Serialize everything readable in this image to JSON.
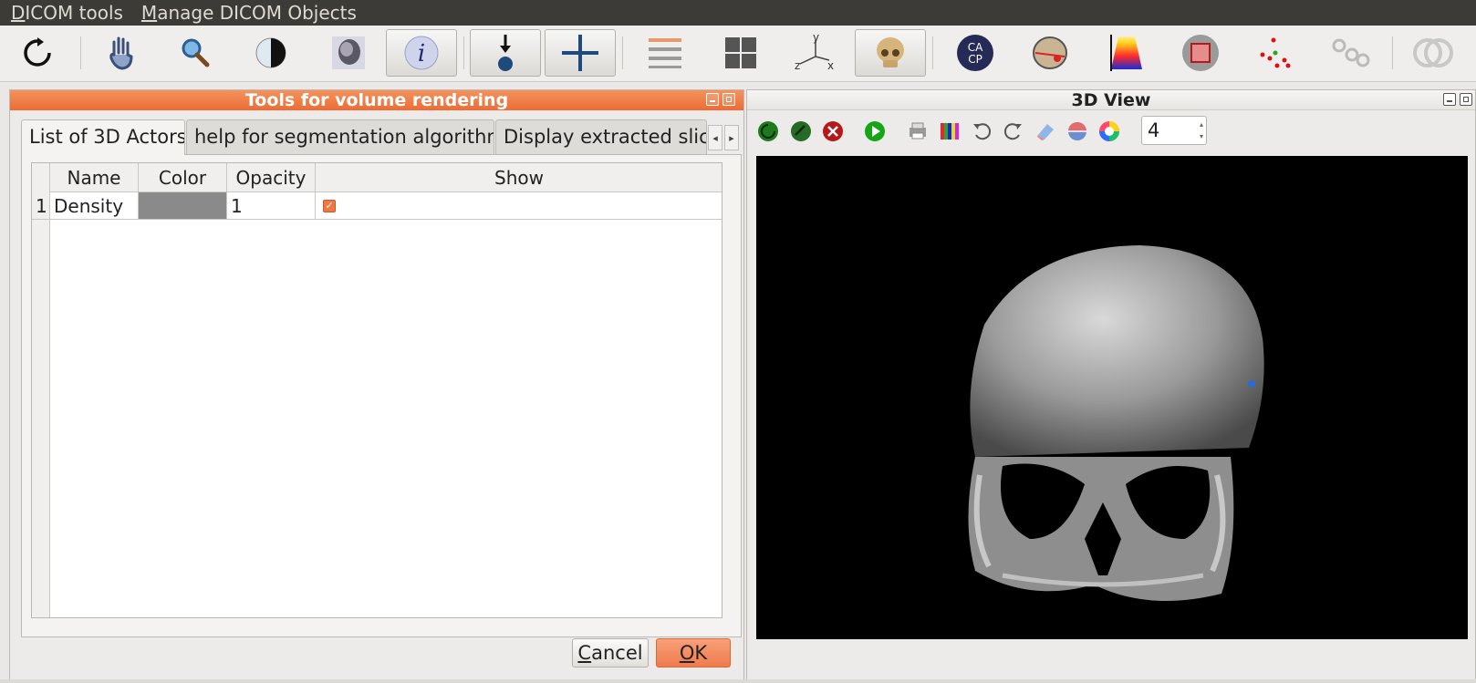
{
  "menubar": {
    "items": [
      {
        "accel": "D",
        "rest": "ICOM tools"
      },
      {
        "accel": "M",
        "rest": "anage DICOM Objects"
      }
    ]
  },
  "toolbar": {
    "buttons": [
      "reset-icon",
      "hand-pan-icon",
      "zoom-magnifier-icon",
      "contrast-icon",
      "head-scan-icon",
      "info-icon",
      "point-marker-icon",
      "crosshair-plus-icon",
      "horizontal-lines-icon",
      "grid-layout-icon",
      "axes-xyz-icon",
      "skull-3d-icon",
      "cacp-icon",
      "skull-measure-icon",
      "color-ramp-icon",
      "cube-icon",
      "point-cloud-icon",
      "path-icon",
      "rings-icon"
    ],
    "axes_labels": {
      "y": "y",
      "z": "z",
      "x": "x"
    },
    "cacp_text": {
      "line1": "CA",
      "line2": "CP"
    }
  },
  "left_panel": {
    "title": "Tools for volume rendering",
    "tabs": [
      {
        "label": "List of 3D Actors",
        "active": true
      },
      {
        "label": "help for segmentation algorithm",
        "active": false
      },
      {
        "label": "Display extracted slice",
        "active": false
      }
    ],
    "table": {
      "columns": [
        "Name",
        "Color",
        "Opacity",
        "Show"
      ],
      "rows": [
        {
          "index": "1",
          "name": "Density",
          "color": "#8a8a8a",
          "opacity": "1",
          "show": true
        }
      ]
    },
    "buttons": {
      "cancel": {
        "accel": "C",
        "rest": "ancel"
      },
      "ok": {
        "accel": "O",
        "rest": "K"
      }
    }
  },
  "right_panel": {
    "title": "3D View",
    "tools": [
      "refresh-green-icon",
      "rotate-green-icon",
      "close-red-icon",
      "play-icon",
      "printer-icon",
      "color-bars-icon",
      "undo-icon",
      "redo-icon",
      "eraser-icon",
      "sphere-cut-icon",
      "color-wheel-icon"
    ],
    "spin_value": "4"
  },
  "colors": {
    "accent_orange": "#ec6c35",
    "menubar_bg": "#3c3b37",
    "viewport_bg": "#000000"
  }
}
